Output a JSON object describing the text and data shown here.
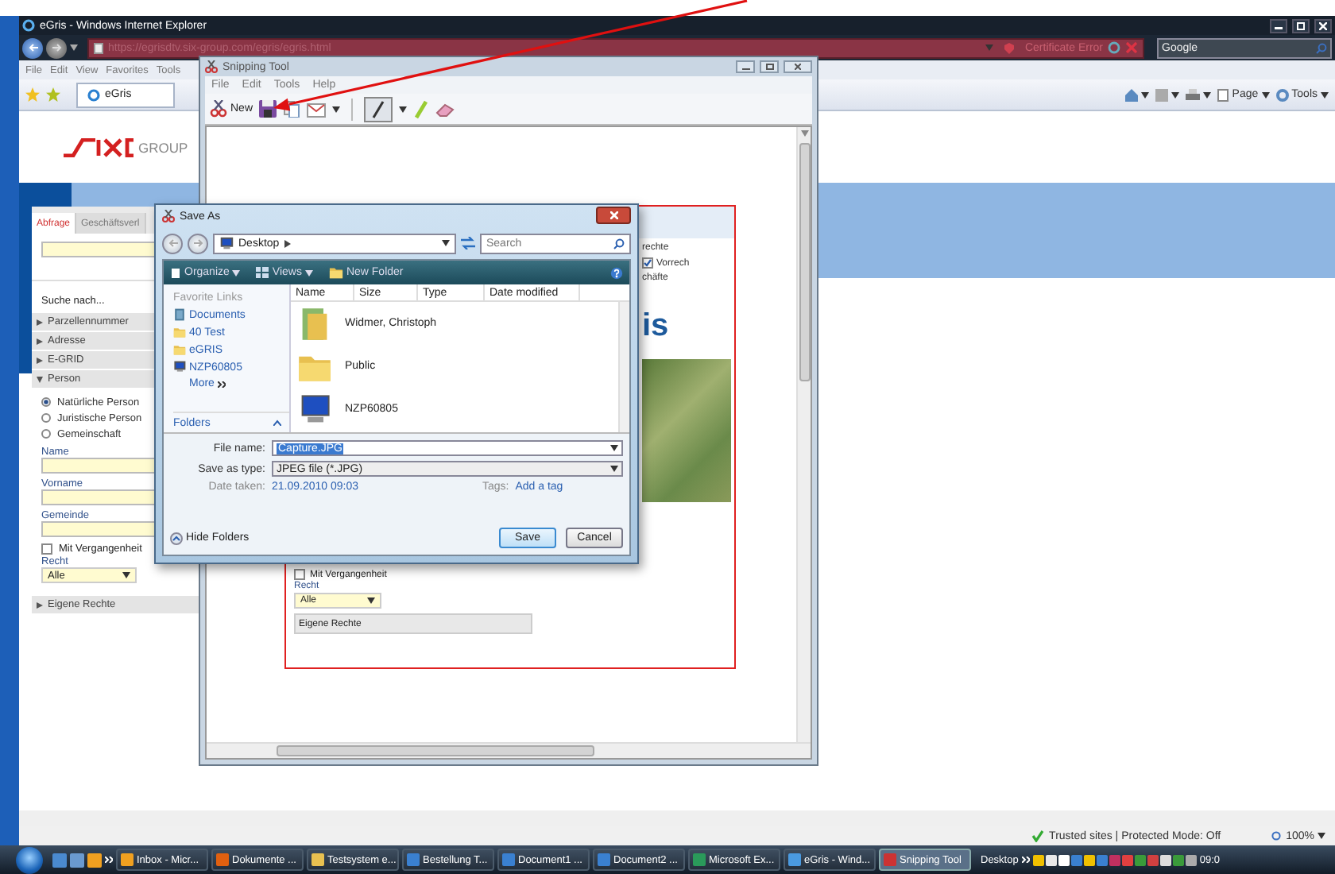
{
  "browser": {
    "title": "eGris - Windows Internet Explorer",
    "address": "https://egrisdtv.six-group.com/egris/egris.html",
    "certificate": "Certificate Error",
    "search_placeholder": "Google",
    "menu": [
      "File",
      "Edit",
      "View",
      "Favorites",
      "Tools"
    ],
    "tab": "eGris",
    "commands": [
      "Page",
      "Tools"
    ],
    "status": "Trusted sites | Protected Mode: Off",
    "zoom": "100%"
  },
  "page": {
    "logo": "GROUP",
    "tabs": [
      {
        "label": "Abfrage",
        "selected": true
      },
      {
        "label": "Geschäftsverl",
        "selected": false
      }
    ],
    "search_label": "Suche nach...",
    "sections": [
      {
        "label": "Parzellennummer",
        "expanded": false
      },
      {
        "label": "Adresse",
        "expanded": false
      },
      {
        "label": "E-GRID",
        "expanded": false
      },
      {
        "label": "Person",
        "expanded": true
      }
    ],
    "radios": [
      {
        "label": "Natürliche Person",
        "selected": true
      },
      {
        "label": "Juristische Person",
        "selected": false
      },
      {
        "label": "Gemeinschaft",
        "selected": false
      }
    ],
    "fields": [
      "Name",
      "Vorname",
      "Gemeinde"
    ],
    "checkbox": {
      "label": "Mit Vergangenheit",
      "checked": false
    },
    "recht_label": "Recht",
    "recht_value": "Alle",
    "footer_section": "Eigene Rechte"
  },
  "snipping_tool": {
    "title": "Snipping Tool",
    "menu": [
      "File",
      "Edit",
      "Tools",
      "Help"
    ],
    "new": "New",
    "capture": {
      "fragment_1": "rechte",
      "option": {
        "label": "Vorrech",
        "checked": true
      },
      "fragment_2": "chäfte",
      "heading": "is",
      "checkbox": {
        "label": "Mit Vergangenheit",
        "checked": false
      },
      "recht_label": "Recht",
      "recht_value": "Alle",
      "section": "Eigene Rechte"
    }
  },
  "save_dialog": {
    "title": "Save As",
    "location": "Desktop",
    "search_placeholder": "Search",
    "toolbar": [
      "Organize",
      "Views",
      "New Folder"
    ],
    "favorites_title": "Favorite Links",
    "favorites": [
      {
        "label": "Documents",
        "kind": "documents"
      },
      {
        "label": "40 Test",
        "kind": "folder"
      },
      {
        "label": "eGRIS",
        "kind": "folder"
      },
      {
        "label": "NZP60805",
        "kind": "computer"
      }
    ],
    "more": "More",
    "folders": "Folders",
    "columns": [
      "Name",
      "Size",
      "Type",
      "Date modified"
    ],
    "files": [
      {
        "name": "Widmer, Christoph",
        "kind": "user"
      },
      {
        "name": "Public",
        "kind": "folder"
      },
      {
        "name": "NZP60805",
        "kind": "computer"
      }
    ],
    "file_name_label": "File name:",
    "file_name": "Capture.JPG",
    "type_label": "Save as type:",
    "type": "JPEG file (*.JPG)",
    "date_label": "Date taken:",
    "date": "21.09.2010 09:03",
    "tags_label": "Tags:",
    "tags": "Add a tag",
    "hide_folders": "Hide Folders",
    "buttons": [
      "Save",
      "Cancel"
    ]
  },
  "taskbar": {
    "items": [
      {
        "label": "Inbox - Micr...",
        "selected": false
      },
      {
        "label": "Dokumente ...",
        "selected": false
      },
      {
        "label": "Testsystem e...",
        "selected": false
      },
      {
        "label": "Bestellung T...",
        "selected": false
      },
      {
        "label": "Document1 ...",
        "selected": false
      },
      {
        "label": "Document2 ...",
        "selected": false
      },
      {
        "label": "Microsoft Ex...",
        "selected": false
      },
      {
        "label": "eGris - Wind...",
        "selected": false
      },
      {
        "label": "Snipping Tool",
        "selected": true
      }
    ],
    "desktop": "Desktop",
    "clock": "09:0"
  }
}
